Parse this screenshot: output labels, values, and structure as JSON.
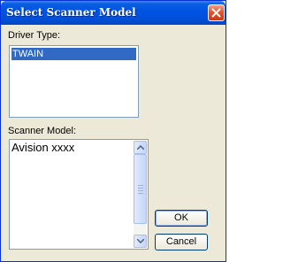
{
  "dialog": {
    "title": "Select Scanner Model"
  },
  "driver_type": {
    "label": "Driver Type:",
    "items": [
      "TWAIN"
    ],
    "selected": "TWAIN"
  },
  "scanner_model": {
    "label": "Scanner Model:",
    "items": [
      "Avision xxxx"
    ]
  },
  "buttons": {
    "ok": "OK",
    "cancel": "Cancel"
  },
  "icons": {
    "close": "close-icon",
    "scroll_up": "scroll-up-arrow-icon",
    "scroll_down": "scroll-down-arrow-icon"
  },
  "colors": {
    "title_bar": "#0054e3",
    "selection": "#316ac5",
    "close_button": "#e1552e",
    "dialog_bg": "#ece9d8"
  }
}
